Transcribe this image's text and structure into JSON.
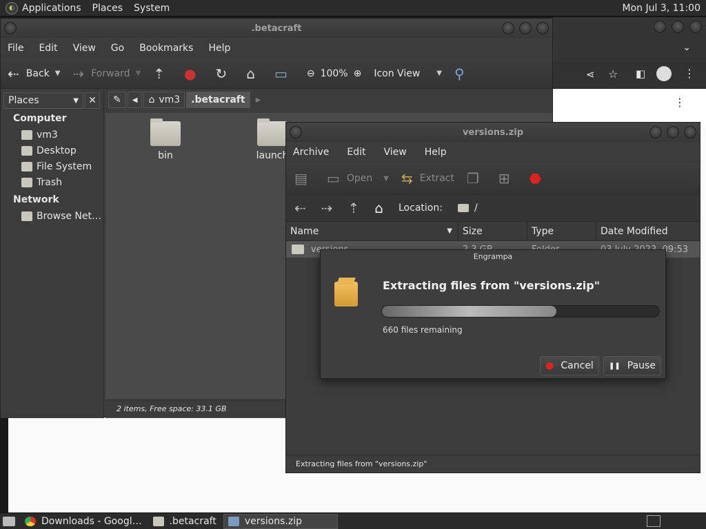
{
  "top_panel": {
    "menus": [
      "Applications",
      "Places",
      "System"
    ],
    "clock": "Mon Jul  3, 11:00"
  },
  "caja": {
    "title": ".betacraft",
    "menu": [
      "File",
      "Edit",
      "View",
      "Go",
      "Bookmarks",
      "Help"
    ],
    "toolbar": {
      "back": "Back",
      "forward": "Forward",
      "zoom": "100%",
      "view_mode": "Icon View"
    },
    "places_label": "Places",
    "sidebar": {
      "computer_heading": "Computer",
      "computer_items": [
        "vm3",
        "Desktop",
        "File System",
        "Trash"
      ],
      "network_heading": "Network",
      "network_items": [
        "Browse Net…"
      ]
    },
    "path": [
      "vm3",
      ".betacraft"
    ],
    "folders": [
      "bin",
      "launch"
    ],
    "status": "2 items, Free space: 33.1 GB"
  },
  "engrampa": {
    "title": "versions.zip",
    "menu": [
      "Archive",
      "Edit",
      "View",
      "Help"
    ],
    "toolbar": {
      "open": "Open",
      "extract": "Extract"
    },
    "location_label": "Location:",
    "location_value": "/",
    "columns": [
      "Name",
      "Size",
      "Type",
      "Date Modified"
    ],
    "rows": [
      {
        "name": "versions",
        "size": "2.3 GB",
        "type": "Folder",
        "date": "03 July 2023, 09:53"
      }
    ],
    "status": "Extracting files from \"versions.zip\""
  },
  "dialog": {
    "title": "Engrampa",
    "heading": "Extracting files from \"versions.zip\"",
    "progress_fraction": 0.63,
    "remaining": "660 files remaining",
    "cancel": "Cancel",
    "pause": "Pause"
  },
  "taskbar": {
    "items": [
      "Downloads - Googl…",
      ".betacraft",
      "versions.zip"
    ]
  }
}
